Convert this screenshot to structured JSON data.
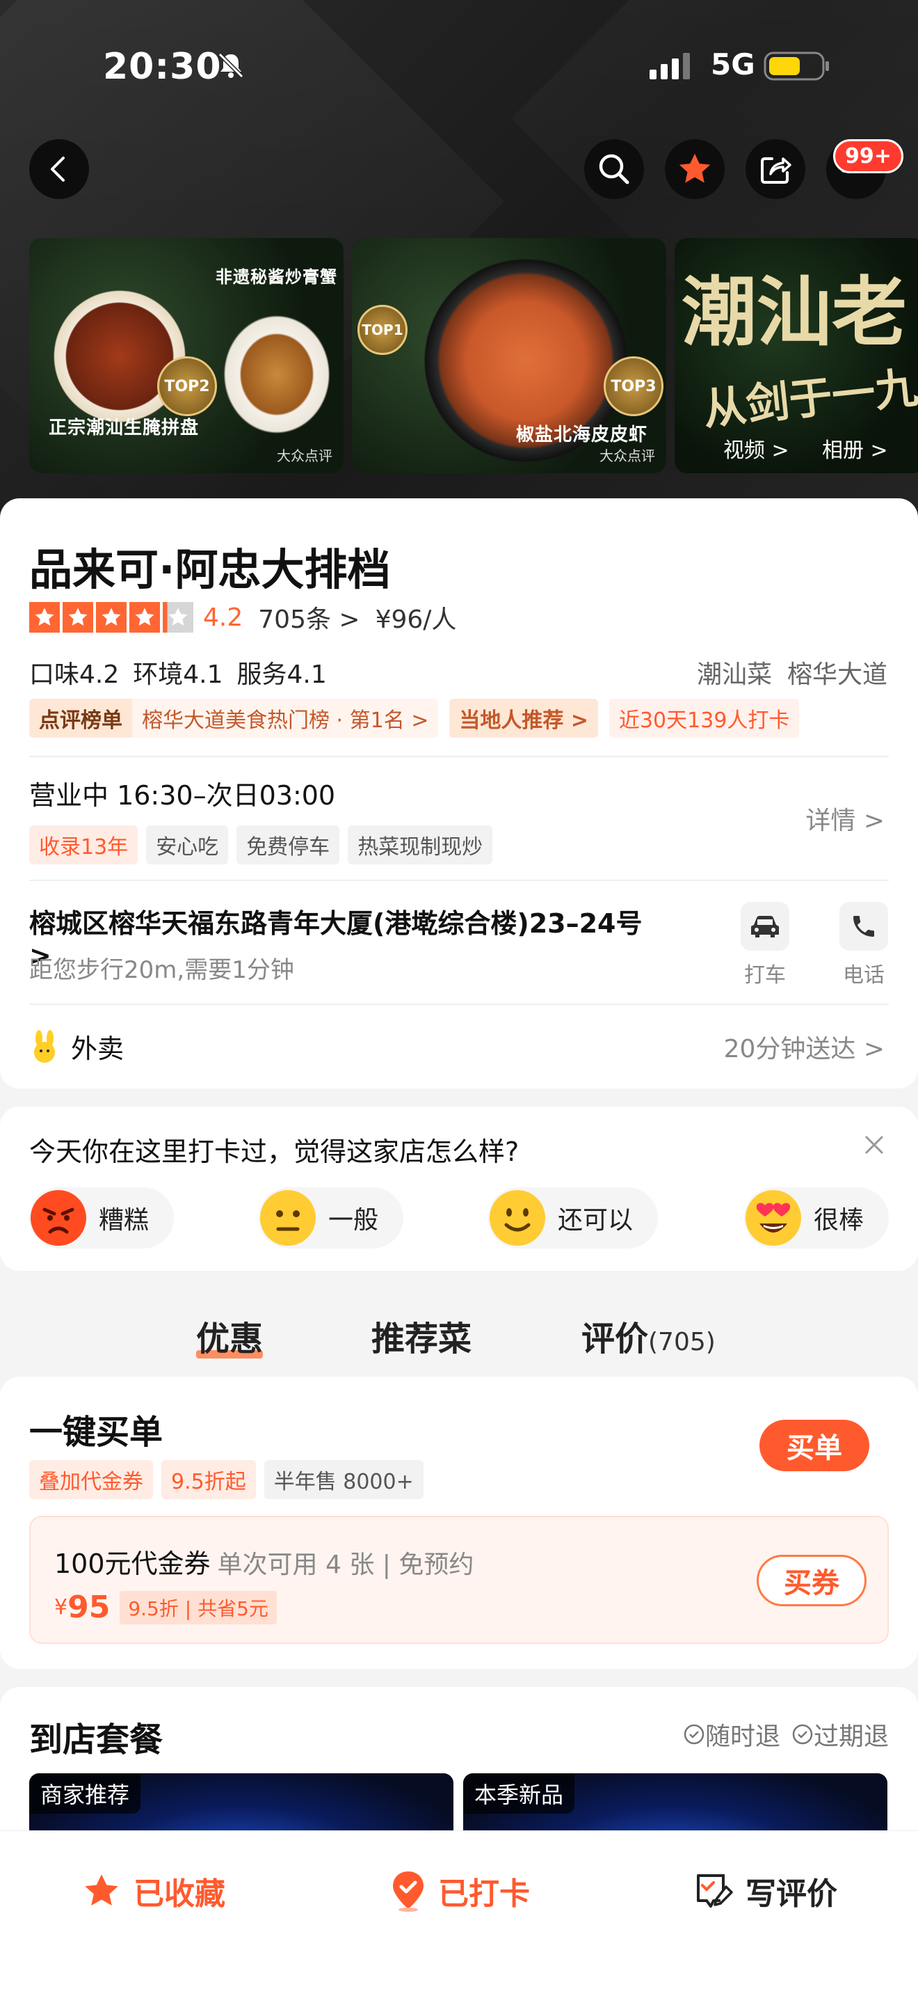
{
  "status_bar": {
    "time": "20:30",
    "network": "5G"
  },
  "topbar": {
    "badge": "99+"
  },
  "gallery": {
    "photo1": {
      "caption_top": "非遗秘酱炒膏蟹",
      "caption_bottom": "正宗潮汕生腌拼盘",
      "medal": "TOP2",
      "watermark": "大众点评"
    },
    "photo2": {
      "caption_bottom": "椒盐北海皮皮虾",
      "medal": "TOP3",
      "medal2": "TOP1",
      "watermark": "大众点评"
    },
    "photo3": {
      "calligraphy": "潮汕老",
      "calligraphy2": "从剑于一九",
      "video_link": "视频 >",
      "album_link": "相册 >"
    }
  },
  "shop": {
    "name": "品来可·阿忠大排档",
    "rating": "4.2",
    "stars": 4.2,
    "reviews": "705条 >",
    "price": "¥96/人",
    "scores": [
      "口味4.2",
      "环境4.1",
      "服务4.1"
    ],
    "categories": [
      "潮汕菜",
      "榕华大道"
    ],
    "rank_label": "点评榜单",
    "rank_text": "榕华大道美食热门榜 · 第1名 >",
    "local_tag": "当地人推荐 >",
    "checkin_tag": "近30天139人打卡",
    "hours": "营业中  16:30–次日03:00",
    "detail": "详情 >",
    "chips": [
      "收录13年",
      "安心吃",
      "免费停车",
      "热菜现制现炒"
    ],
    "address": "榕城区榕华天福东路青年大厦(港墘综合楼)23–24号 >",
    "distance": "距您步行20m,需要1分钟",
    "taxi": "打车",
    "phone": "电话",
    "takeout": "外卖",
    "delivery": "20分钟送达 >"
  },
  "feedback": {
    "question": "今天你在这里打卡过，觉得这家店怎么样?",
    "options": [
      "糟糕",
      "一般",
      "还可以",
      "很棒"
    ]
  },
  "tabs": {
    "deals": "优惠",
    "dishes": "推荐菜",
    "reviews": "评价",
    "reviews_count": "(705)"
  },
  "quick_pay": {
    "title": "一键买单",
    "button": "买单",
    "tags": [
      "叠加代金券",
      "9.5折起",
      "半年售 8000+"
    ],
    "voucher_title": "100元代金券",
    "voucher_terms": "单次可用 4 张 | 免预约",
    "currency": "¥",
    "price": "95",
    "discount": "9.5折 | 共省5元",
    "voucher_button": "买券"
  },
  "packages": {
    "title": "到店套餐",
    "policy1": "随时退",
    "policy2": "过期退",
    "label1": "商家推荐",
    "label2": "本季新品"
  },
  "bottom_bar": {
    "favorited": "已收藏",
    "checked_in": "已打卡",
    "write_review": "写评价"
  },
  "colors": {
    "accent": "#ff5a2e",
    "star": "#ff6633"
  }
}
